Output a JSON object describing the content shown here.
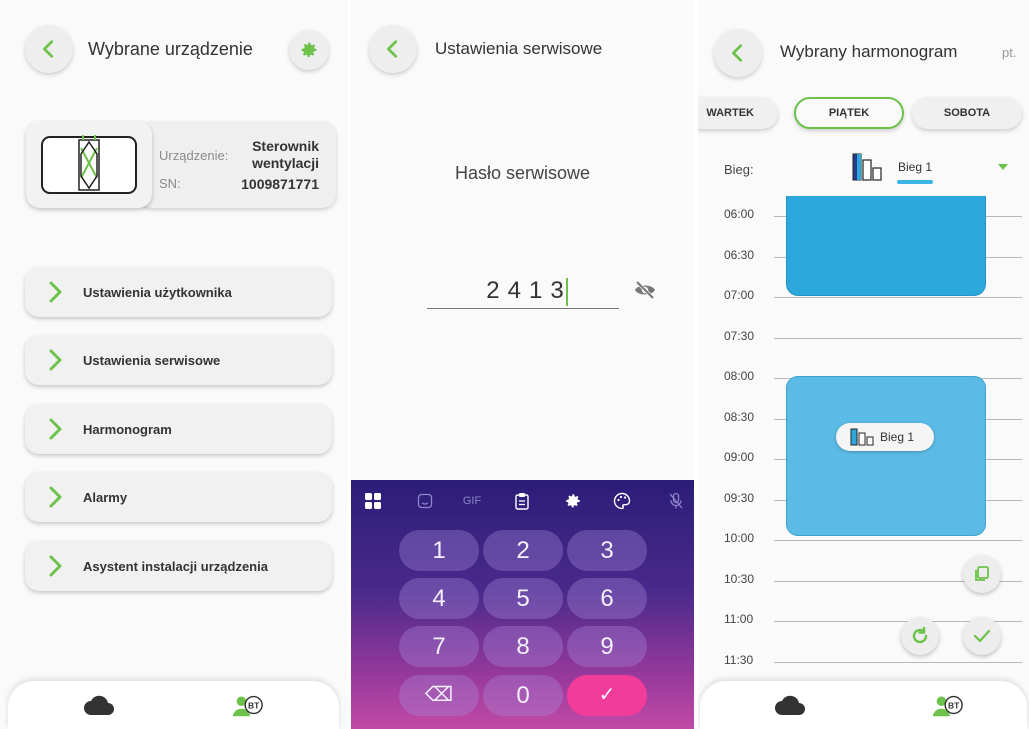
{
  "screen1": {
    "title": "Wybrane urządzenie",
    "device": {
      "label_device": "Urządzenie:",
      "value_device_line1": "Sterownik",
      "value_device_line2": "wentylacji",
      "label_sn": "SN:",
      "value_sn": "1009871771"
    },
    "menu": [
      {
        "label": "Ustawienia użytkownika"
      },
      {
        "label": "Ustawienia serwisowe"
      },
      {
        "label": "Harmonogram"
      },
      {
        "label": "Alarmy"
      },
      {
        "label": "Asystent instalacji urządzenia"
      }
    ],
    "bottom_bar": {
      "bt_badge": "BT"
    }
  },
  "screen2": {
    "title": "Ustawienia serwisowe",
    "password_label": "Hasło serwisowe",
    "password_value": "2413",
    "keyboard": {
      "toolbar": [
        "grid-icon",
        "sticker-icon",
        "GIF",
        "clipboard-icon",
        "gear-icon",
        "palette-icon",
        "mic-off-icon"
      ],
      "gif_label": "GIF",
      "keys": [
        "1",
        "2",
        "3",
        "4",
        "5",
        "6",
        "7",
        "8",
        "9",
        "⌫",
        "0",
        "✓"
      ]
    }
  },
  "screen3": {
    "title": "Wybrany harmonogram",
    "subtitle": "pt.",
    "days": [
      {
        "label": "WARTEK",
        "active": false
      },
      {
        "label": "PIĄTEK",
        "active": true
      },
      {
        "label": "SOBOTA",
        "active": false
      }
    ],
    "bieg_label": "Bieg:",
    "bieg_value": "Bieg 1",
    "times": [
      "06:00",
      "06:30",
      "07:00",
      "07:30",
      "08:00",
      "08:30",
      "09:00",
      "09:30",
      "10:00",
      "10:30",
      "11:00",
      "11:30"
    ],
    "block_badge": "Bieg 1",
    "bottom_bar": {
      "bt_badge": "BT"
    }
  },
  "colors": {
    "accent_green": "#6cc24a",
    "block_blue": "#2da8dc",
    "block_light_blue": "#5bbbe6",
    "keyboard_confirm": "#f23c9a"
  }
}
